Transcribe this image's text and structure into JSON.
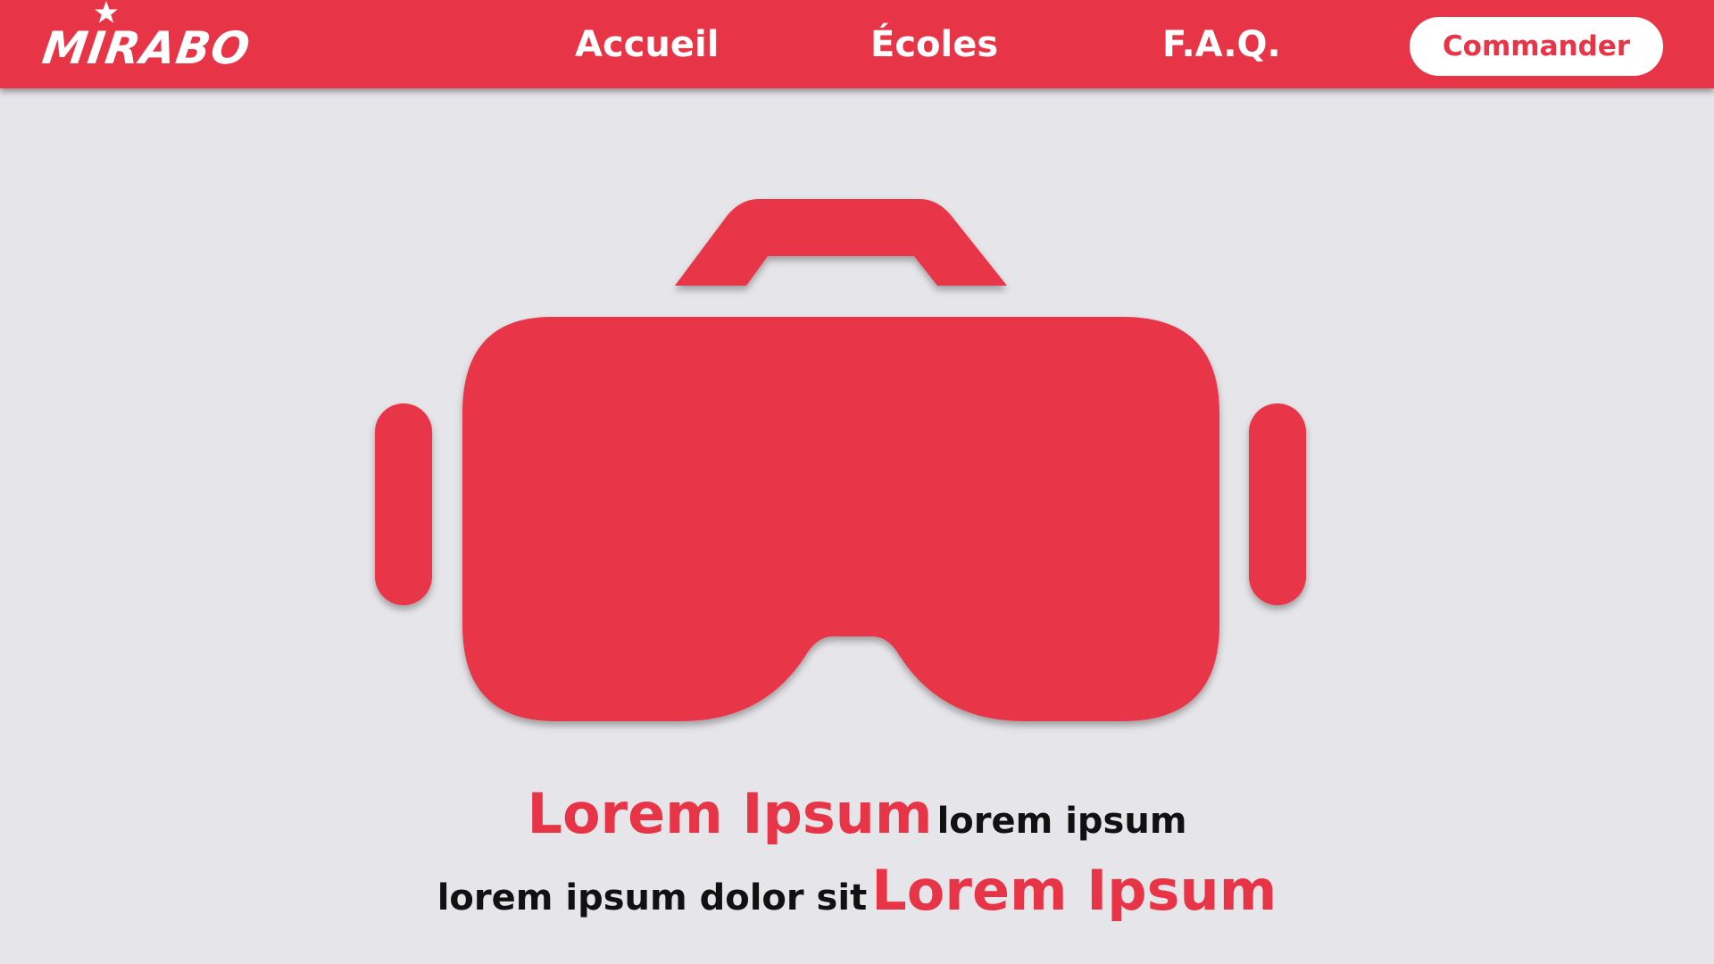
{
  "brand": {
    "name": "MIRABO",
    "logo_icon": "star-icon"
  },
  "nav": {
    "items": [
      {
        "label": "Accueil"
      },
      {
        "label": "Écoles"
      },
      {
        "label": "F.A.Q."
      }
    ],
    "cta_label": "Commander"
  },
  "hero": {
    "icon": "vr-headset-icon",
    "line1": {
      "highlight": "Lorem Ipsum",
      "text": "lorem ipsum"
    },
    "line2": {
      "text": "lorem ipsum dolor sit",
      "highlight": "Lorem Ipsum"
    }
  },
  "colors": {
    "accent": "#e83447",
    "background": "#e6e5e9",
    "text_dark": "#111111",
    "white": "#ffffff"
  }
}
